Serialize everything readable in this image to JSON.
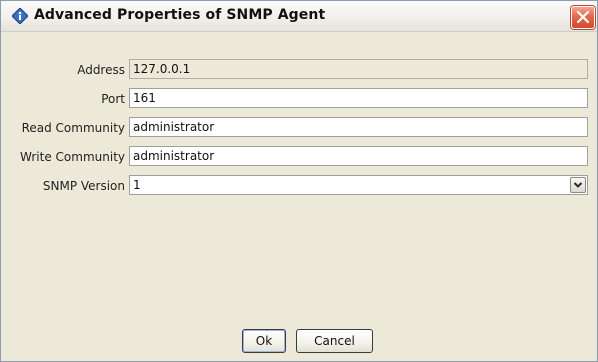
{
  "window": {
    "title": "Advanced Properties of SNMP Agent",
    "icons": {
      "title_icon": "info-diamond-icon",
      "close_icon": "close-x-icon"
    }
  },
  "form": {
    "address_label": "Address",
    "address_value": "127.0.0.1",
    "port_label": "Port",
    "port_value": "161",
    "read_community_label": "Read Community",
    "read_community_value": "administrator",
    "write_community_label": "Write Community",
    "write_community_value": "administrator",
    "snmp_version_label": "SNMP Version",
    "snmp_version_value": "1"
  },
  "buttons": {
    "ok_label": "Ok",
    "cancel_label": "Cancel"
  },
  "colors": {
    "close_button": "#d24a2b",
    "title_icon": "#3b6fc7"
  }
}
